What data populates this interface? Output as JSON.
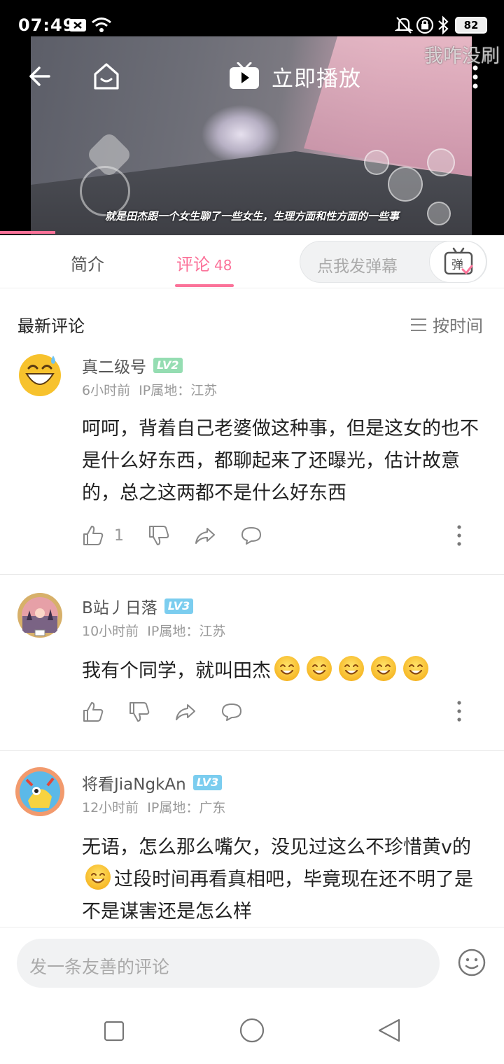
{
  "status_bar": {
    "time": "07:49",
    "battery": "82"
  },
  "video": {
    "play_label": "立即播放",
    "subtitle": "就是田杰跟一个女生聊了一些女生，生理方面和性方面的一些事",
    "watermark": "我咋没刷",
    "progress_fraction": 0.11
  },
  "tabs": {
    "intro": "简介",
    "comments": "评论",
    "comments_count": "48",
    "danmaku_placeholder": "点我发弹幕"
  },
  "section": {
    "title": "最新评论",
    "sort_label": "按时间"
  },
  "comments": [
    {
      "username": "真二级号",
      "level": "LV2",
      "level_color": "#95ddb2",
      "time": "6小时前",
      "location": "IP属地：江苏",
      "text": "呵呵，背着自己老婆做这种事，但是这女的也不是什么好东西，都聊起来了还曝光，估计故意的，总之这两都不是什么好东西",
      "likes": "1"
    },
    {
      "username": "B站丿日落",
      "level": "LV3",
      "level_color": "#7bcdef",
      "time": "10小时前",
      "location": "IP属地：江苏",
      "text": "我有个同学，就叫田杰",
      "likes": ""
    },
    {
      "username": "将看JiaNgkAn",
      "level": "LV3",
      "level_color": "#7bcdef",
      "time": "12小时前",
      "location": "IP属地：广东",
      "text_a": "无语，怎么那么嘴欠，没见过这么不珍惜黄v的",
      "text_b": "过段时间再看真相吧，毕竟现在还不明了是不是谋害还是怎么样",
      "likes": ""
    }
  ],
  "bottom": {
    "comment_placeholder": "发一条友善的评论"
  },
  "colors": {
    "accent": "#fb7299"
  }
}
